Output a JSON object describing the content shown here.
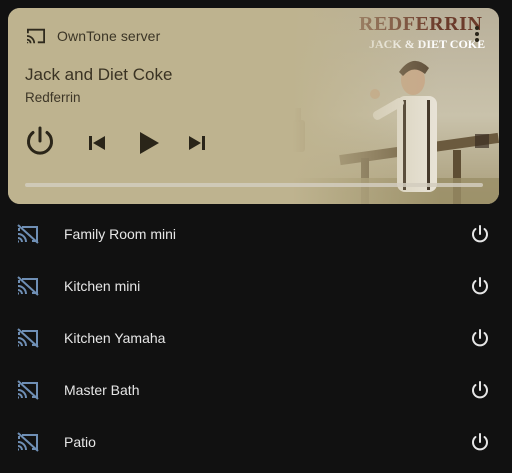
{
  "player": {
    "server_name": "OwnTone server",
    "track_title": "Jack and Diet Coke",
    "artist": "Redferrin",
    "progress_fraction": 0.0,
    "album_art": {
      "artist_text": "REDFERRIN",
      "title_text": "JACK & DIET COKE"
    },
    "icons": {
      "cast": "cast-icon",
      "more": "more-vertical-icon",
      "power": "power-icon",
      "previous": "skip-previous-icon",
      "play": "play-icon",
      "next": "skip-next-icon"
    },
    "colors": {
      "card_background": "#beb38f",
      "card_text": "#3a3323"
    }
  },
  "devices": [
    {
      "name": "Family Room mini",
      "icon": "cast-off-icon",
      "power_icon": "power-icon"
    },
    {
      "name": "Kitchen mini",
      "icon": "cast-off-icon",
      "power_icon": "power-icon"
    },
    {
      "name": "Kitchen Yamaha",
      "icon": "cast-off-icon",
      "power_icon": "power-icon"
    },
    {
      "name": "Master Bath",
      "icon": "cast-off-icon",
      "power_icon": "power-icon"
    },
    {
      "name": "Patio",
      "icon": "cast-off-icon",
      "power_icon": "power-icon"
    }
  ],
  "colors": {
    "page_background": "#111111",
    "device_text": "#e6e6e6",
    "cast_icon": "#6f8fb5"
  }
}
